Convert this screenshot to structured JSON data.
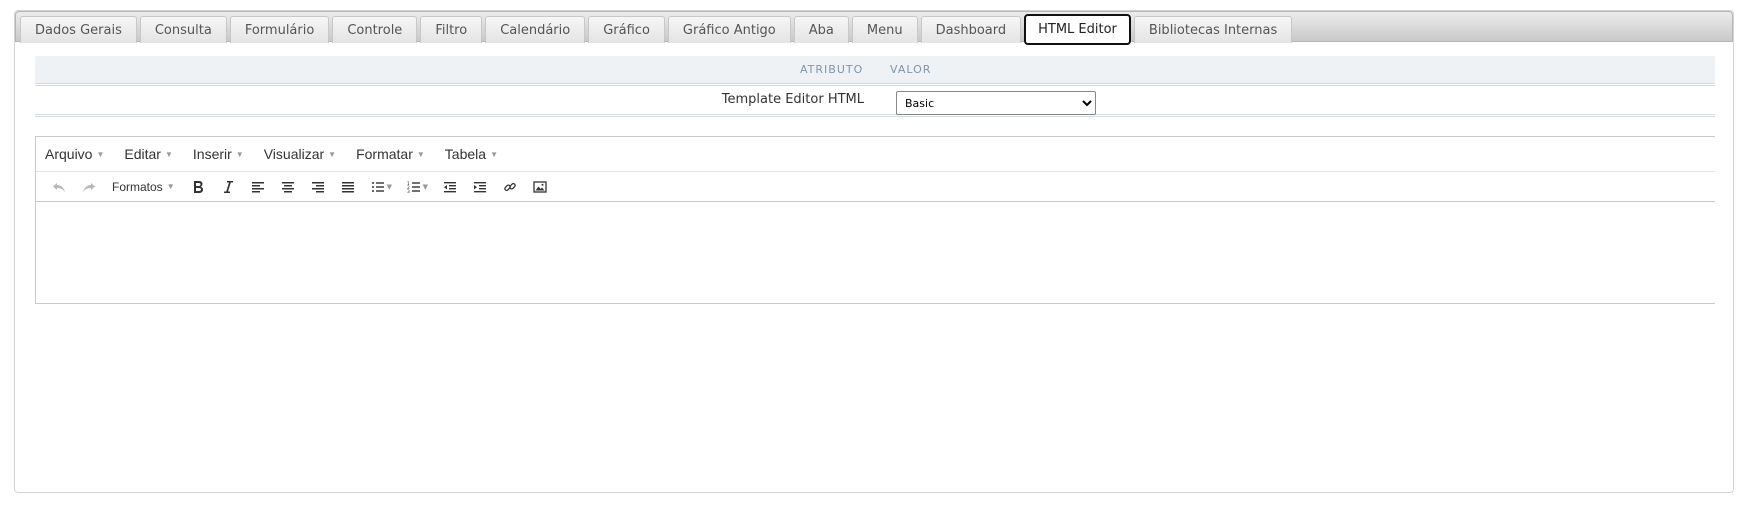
{
  "tabs": [
    {
      "label": "Dados Gerais"
    },
    {
      "label": "Consulta"
    },
    {
      "label": "Formulário"
    },
    {
      "label": "Controle"
    },
    {
      "label": "Filtro"
    },
    {
      "label": "Calendário"
    },
    {
      "label": "Gráfico"
    },
    {
      "label": "Gráfico Antigo"
    },
    {
      "label": "Aba"
    },
    {
      "label": "Menu"
    },
    {
      "label": "Dashboard"
    },
    {
      "label": "HTML Editor",
      "active": true
    },
    {
      "label": "Bibliotecas Internas"
    }
  ],
  "table": {
    "header_attr": "ATRIBUTO",
    "header_value": "VALOR",
    "row_label": "Template Editor HTML",
    "select_value": "Basic"
  },
  "editor": {
    "menus": [
      "Arquivo",
      "Editar",
      "Inserir",
      "Visualizar",
      "Formatar",
      "Tabela"
    ],
    "formats_label": "Formatos",
    "toolbar_icons": [
      "undo-icon",
      "redo-icon",
      "bold-icon",
      "italic-icon",
      "align-left-icon",
      "align-center-icon",
      "align-right-icon",
      "align-justify-icon",
      "bullet-list-icon",
      "numbered-list-icon",
      "outdent-icon",
      "indent-icon",
      "link-icon",
      "image-icon"
    ]
  },
  "colors": {
    "header_text": "#7f96a8",
    "header_bg": "#eef2f5",
    "active_tab_border": "#111111"
  }
}
